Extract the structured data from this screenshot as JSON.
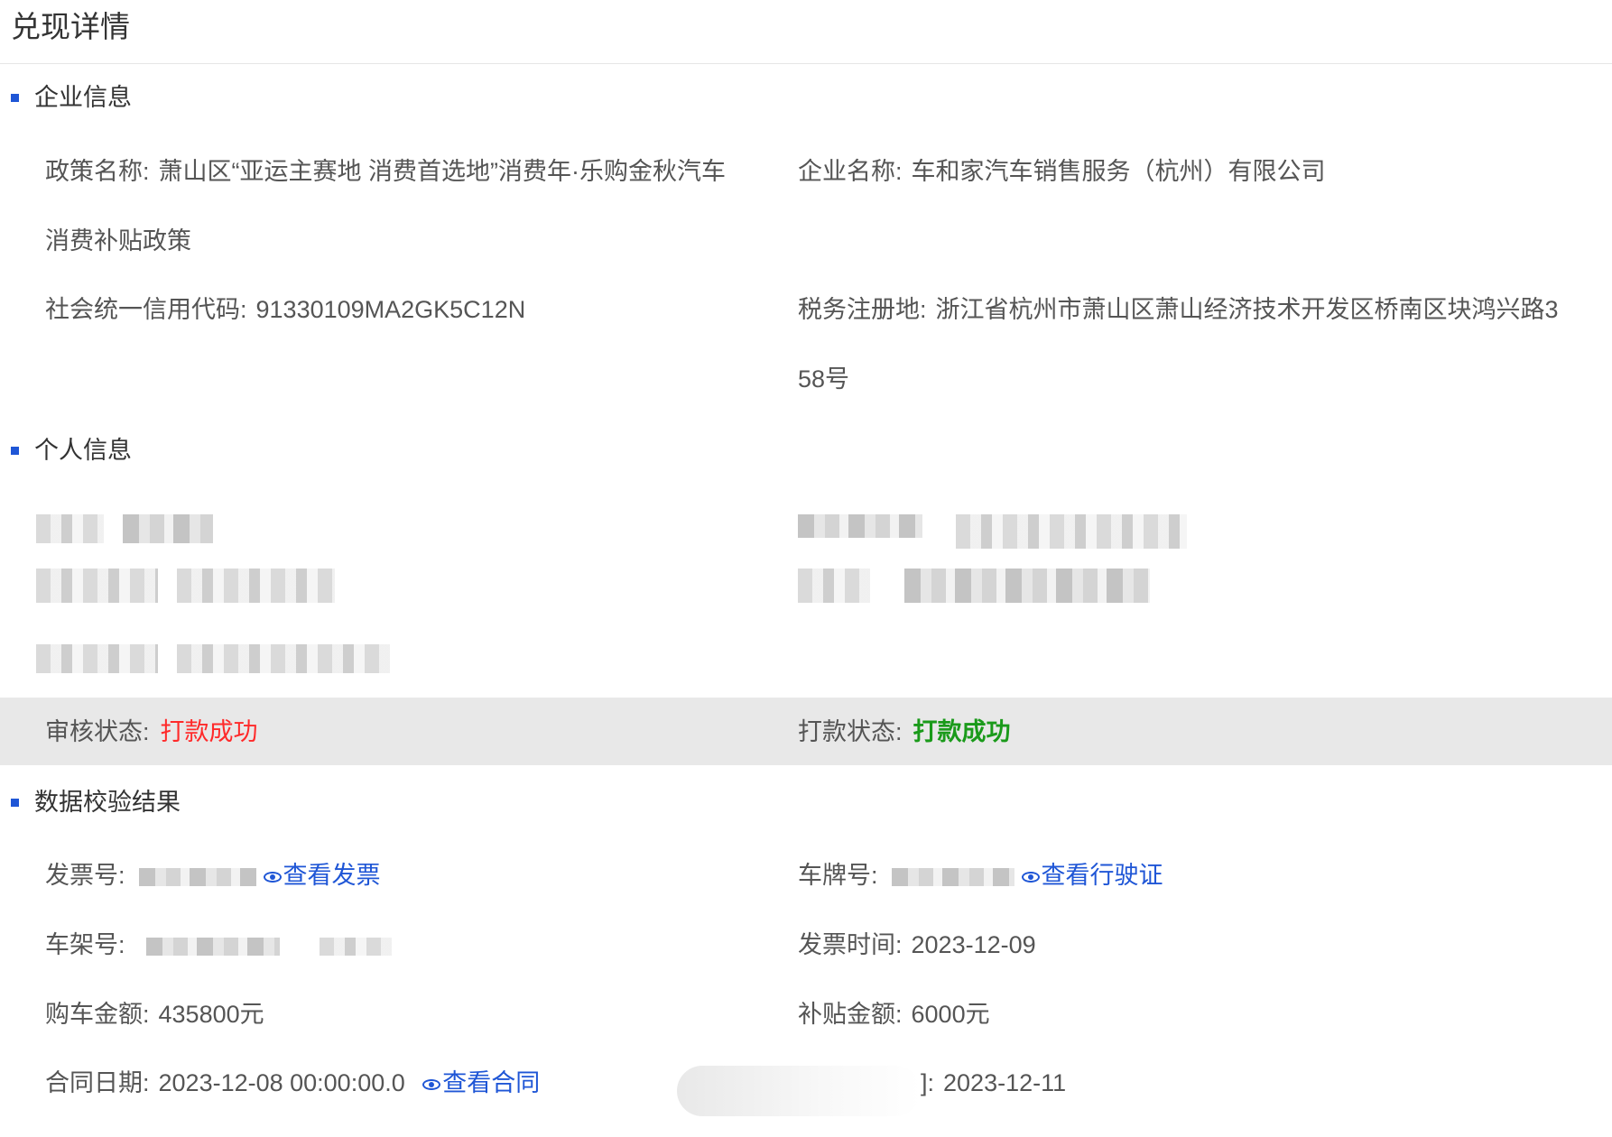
{
  "page": {
    "title": "兑现详情"
  },
  "colors": {
    "accent": "#1f56d6",
    "success_green": "#1a9a1a",
    "alert_red": "#ff2a2a"
  },
  "enterprise_info": {
    "heading": "企业信息",
    "policy_name_label": "政策名称:",
    "policy_name_line1": "萧山区“亚运主赛地 消费首选地”消费年·乐购金秋汽车",
    "policy_name_line2": "消费补贴政策",
    "company_name_label": "企业名称:",
    "company_name": "车和家汽车销售服务（杭州）有限公司",
    "credit_code_label": "社会统一信用代码:",
    "credit_code": "91330109MA2GK5C12N",
    "tax_address_label": "税务注册地:",
    "tax_address_line1": "浙江省杭州市萧山区萧山经济技术开发区桥南区块鸿兴路3",
    "tax_address_line2": "58号"
  },
  "personal_info": {
    "heading": "个人信息"
  },
  "status": {
    "audit_label": "审核状态:",
    "audit_value": "打款成功",
    "payment_label": "打款状态:",
    "payment_value": "打款成功"
  },
  "verification": {
    "heading": "数据校验结果",
    "invoice_label": "发票号:",
    "view_invoice": "查看发票",
    "plate_label": "车牌号:",
    "view_license": "查看行驶证",
    "vin_label": "车架号:",
    "invoice_time_label": "发票时间:",
    "invoice_time": "2023-12-09",
    "purchase_amount_label": "购车金额:",
    "purchase_amount": "435800元",
    "subsidy_amount_label": "补贴金额:",
    "subsidy_amount": "6000元",
    "contract_date_label": "合同日期:",
    "contract_date": "2023-12-08 00:00:00.0",
    "view_contract": "查看合同",
    "partial_label": "]:",
    "partial_value": "2023-12-11"
  }
}
